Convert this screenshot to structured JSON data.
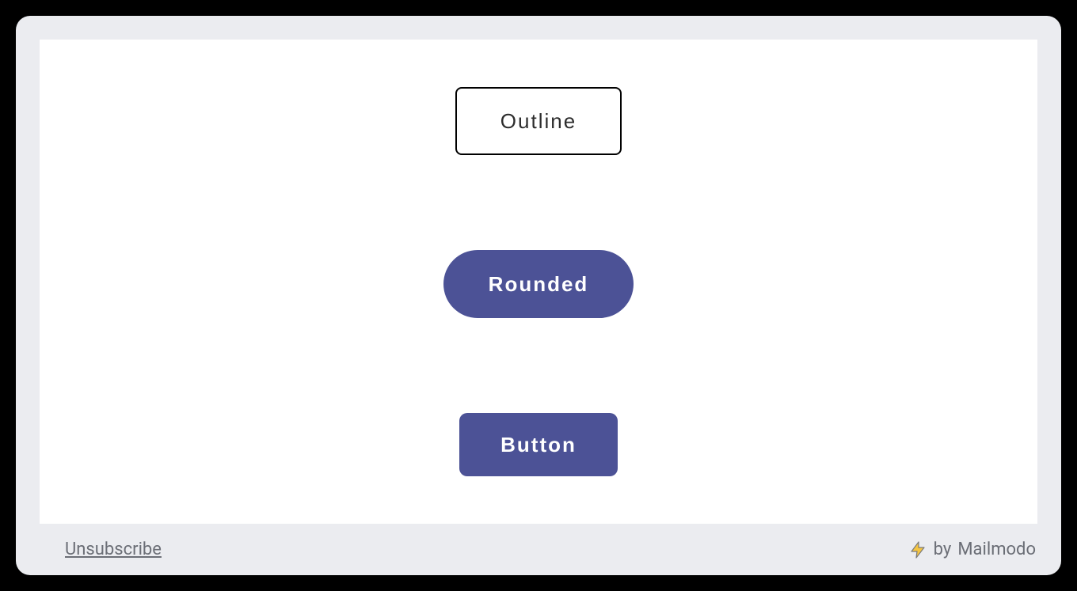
{
  "buttons": {
    "outline": {
      "label": "Outline"
    },
    "rounded": {
      "label": "Rounded"
    },
    "filled": {
      "label": "Button"
    }
  },
  "footer": {
    "unsubscribe": "Unsubscribe",
    "branding_prefix": "by",
    "branding_name": "Mailmodo"
  },
  "colors": {
    "brand": "#4c5296",
    "panel_bg": "#ebecf0",
    "text_muted": "#6b6e76"
  }
}
